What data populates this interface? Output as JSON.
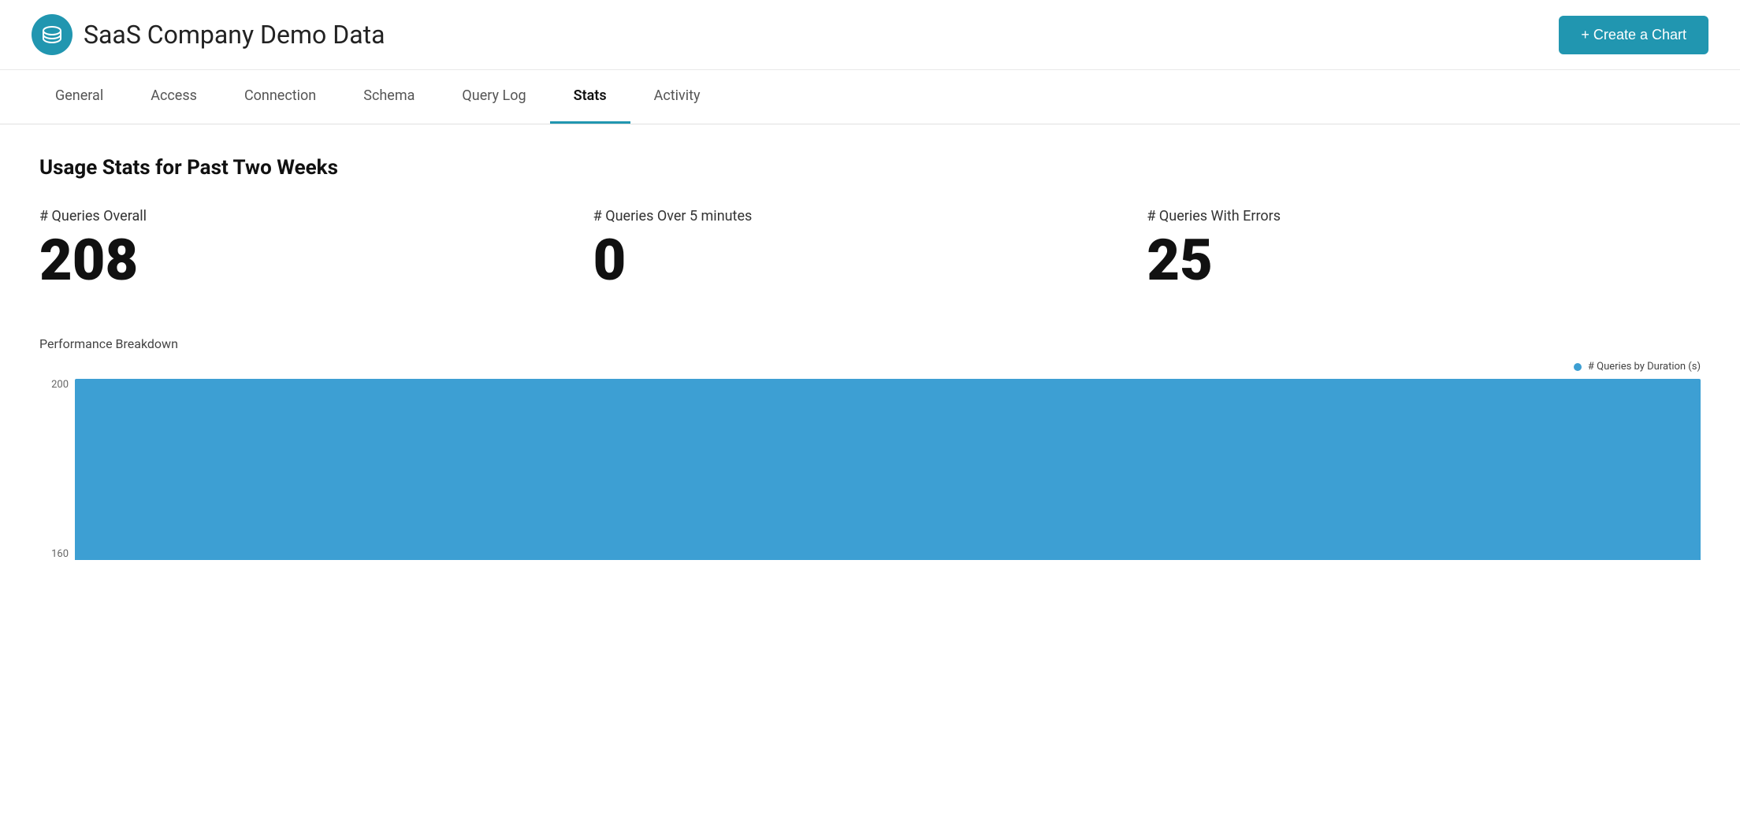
{
  "header": {
    "title": "SaaS Company Demo Data",
    "create_chart_label": "+ Create a Chart",
    "logo_alt": "database-logo"
  },
  "nav": {
    "tabs": [
      {
        "id": "general",
        "label": "General",
        "active": false
      },
      {
        "id": "access",
        "label": "Access",
        "active": false
      },
      {
        "id": "connection",
        "label": "Connection",
        "active": false
      },
      {
        "id": "schema",
        "label": "Schema",
        "active": false
      },
      {
        "id": "query-log",
        "label": "Query Log",
        "active": false
      },
      {
        "id": "stats",
        "label": "Stats",
        "active": true
      },
      {
        "id": "activity",
        "label": "Activity",
        "active": false
      }
    ]
  },
  "main": {
    "section_title": "Usage Stats for Past Two Weeks",
    "stats": [
      {
        "label": "# Queries Overall",
        "value": "208"
      },
      {
        "label": "# Queries Over 5 minutes",
        "value": "0"
      },
      {
        "label": "# Queries With Errors",
        "value": "25"
      }
    ],
    "performance": {
      "title": "Performance Breakdown",
      "legend_label": "# Queries by Duration (s)",
      "y_labels": [
        "200",
        "160"
      ],
      "bar_height_percent": 95
    }
  },
  "colors": {
    "accent": "#2196b0",
    "chart_bar": "#3d9fd3",
    "active_tab_underline": "#2196b0"
  }
}
